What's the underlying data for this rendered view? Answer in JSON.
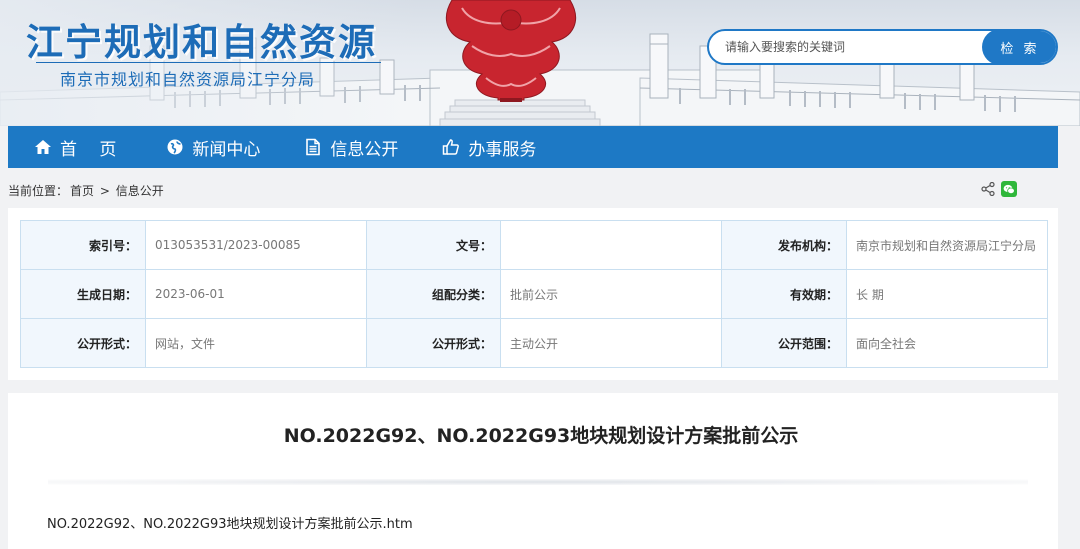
{
  "header": {
    "title": "江宁规划和自然资源",
    "subtitle": "南京市规划和自然资源局江宁分局",
    "search": {
      "placeholder": "请输入要搜索的关键词",
      "button_label": "检 索"
    }
  },
  "nav": {
    "items": [
      {
        "label": "首　 页",
        "icon": "home-icon"
      },
      {
        "label": "新闻中心",
        "icon": "globe-icon"
      },
      {
        "label": "信息公开",
        "icon": "document-icon"
      },
      {
        "label": "办事服务",
        "icon": "thumbs-up-icon"
      }
    ]
  },
  "breadcrumb": {
    "prefix": "当前位置：",
    "home": "首页",
    "separator": ">",
    "current": "信息公开"
  },
  "share": {
    "icons": [
      "share-icon",
      "wechat-icon"
    ]
  },
  "meta": {
    "rows": [
      [
        {
          "key": "索引号：",
          "value": "013053531/2023-00085"
        },
        {
          "key": "文号：",
          "value": ""
        },
        {
          "key": "发布机构：",
          "value": "南京市规划和自然资源局江宁分局"
        }
      ],
      [
        {
          "key": "生成日期：",
          "value": "2023-06-01"
        },
        {
          "key": "组配分类：",
          "value": "批前公示"
        },
        {
          "key": "有效期：",
          "value": "长 期"
        }
      ],
      [
        {
          "key": "公开形式：",
          "value": "网站，文件"
        },
        {
          "key": "公开形式：",
          "value": "主动公开"
        },
        {
          "key": "公开范围：",
          "value": "面向全社会"
        }
      ]
    ]
  },
  "article": {
    "title": "NO.2022G92、NO.2022G93地块规划设计方案批前公示",
    "attachment": "NO.2022G92、NO.2022G93地块规划设计方案批前公示.htm"
  },
  "colors": {
    "brand_blue": "#1d6cb7",
    "nav_blue": "#1d79c5",
    "search_blue": "#1f78c6",
    "table_border": "#c9dff0",
    "key_cell_bg": "#f1f7fd",
    "wechat_green": "#2fb73a",
    "sculpture_red": "#c8252f"
  }
}
